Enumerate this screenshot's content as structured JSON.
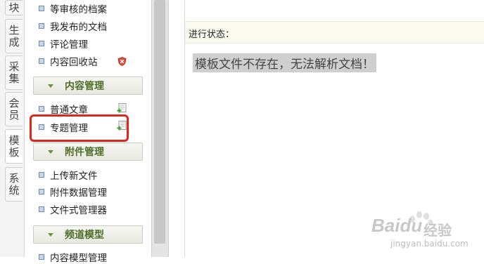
{
  "vtabs": [
    "块",
    "生成",
    "采集",
    "会员",
    "模板",
    "系统"
  ],
  "menu": {
    "top_items": [
      "等审核的档案",
      "我发布的文档",
      "评论管理",
      "内容回收站"
    ],
    "sections": [
      {
        "title": "内容管理",
        "items": [
          "普通文章",
          "专题管理"
        ]
      },
      {
        "title": "附件管理",
        "items": [
          "上传新文件",
          "附件数据管理",
          "文件式管理器"
        ]
      },
      {
        "title": "频道模型",
        "items": [
          "内容模型管理"
        ]
      }
    ]
  },
  "main": {
    "status_label": "进行状态：",
    "message": "模板文件不存在，无法解析文档！"
  },
  "watermark": {
    "brand": "Bai",
    "brand_suffix": "du",
    "brand_cn": "经验",
    "url": "jingyan.baidu.com"
  },
  "colors": {
    "highlight": "#e0251b",
    "section_title": "#4e6f2a",
    "status_bg": "#fafbee"
  }
}
